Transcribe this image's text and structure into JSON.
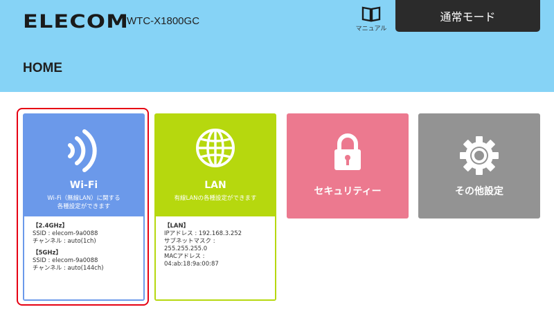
{
  "header": {
    "brand": "ELECOM",
    "model": "WTC-X1800GC",
    "manual_label": "マニュアル",
    "mode_button": "通常モード"
  },
  "page_title": "HOME",
  "cards": {
    "wifi": {
      "title": "Wi-Fi",
      "desc_line1": "Wi-Fi（無線LAN）に関する",
      "desc_line2": "各種設定ができます",
      "band24_head": "【2.4GHz】",
      "band24_ssid": "SSID : elecom-9a0088",
      "band24_channel": "チャンネル : auto(1ch)",
      "band5_head": "【5GHz】",
      "band5_ssid": "SSID : elecom-9a0088",
      "band5_channel": "チャンネル : auto(144ch)"
    },
    "lan": {
      "title": "LAN",
      "desc": "有線LANの各種設定ができます",
      "info_head": "【LAN】",
      "ip": "IPアドレス : 192.168.3.252",
      "mask_label": "サブネットマスク :",
      "mask_value": "255.255.255.0",
      "mac_label": "MACアドレス :",
      "mac_value": "04:ab:18:9a:00:87"
    },
    "security": {
      "title": "セキュリティー"
    },
    "other": {
      "title": "その他設定"
    }
  },
  "colors": {
    "header_bg": "#86d3f6",
    "wifi": "#6b99ea",
    "lan": "#b6d80e",
    "security": "#ec798f",
    "other": "#939393",
    "selected_outline": "#e60012"
  },
  "icons": [
    "book-icon",
    "wifi-signal-icon",
    "globe-icon",
    "lock-icon",
    "gear-icon"
  ]
}
